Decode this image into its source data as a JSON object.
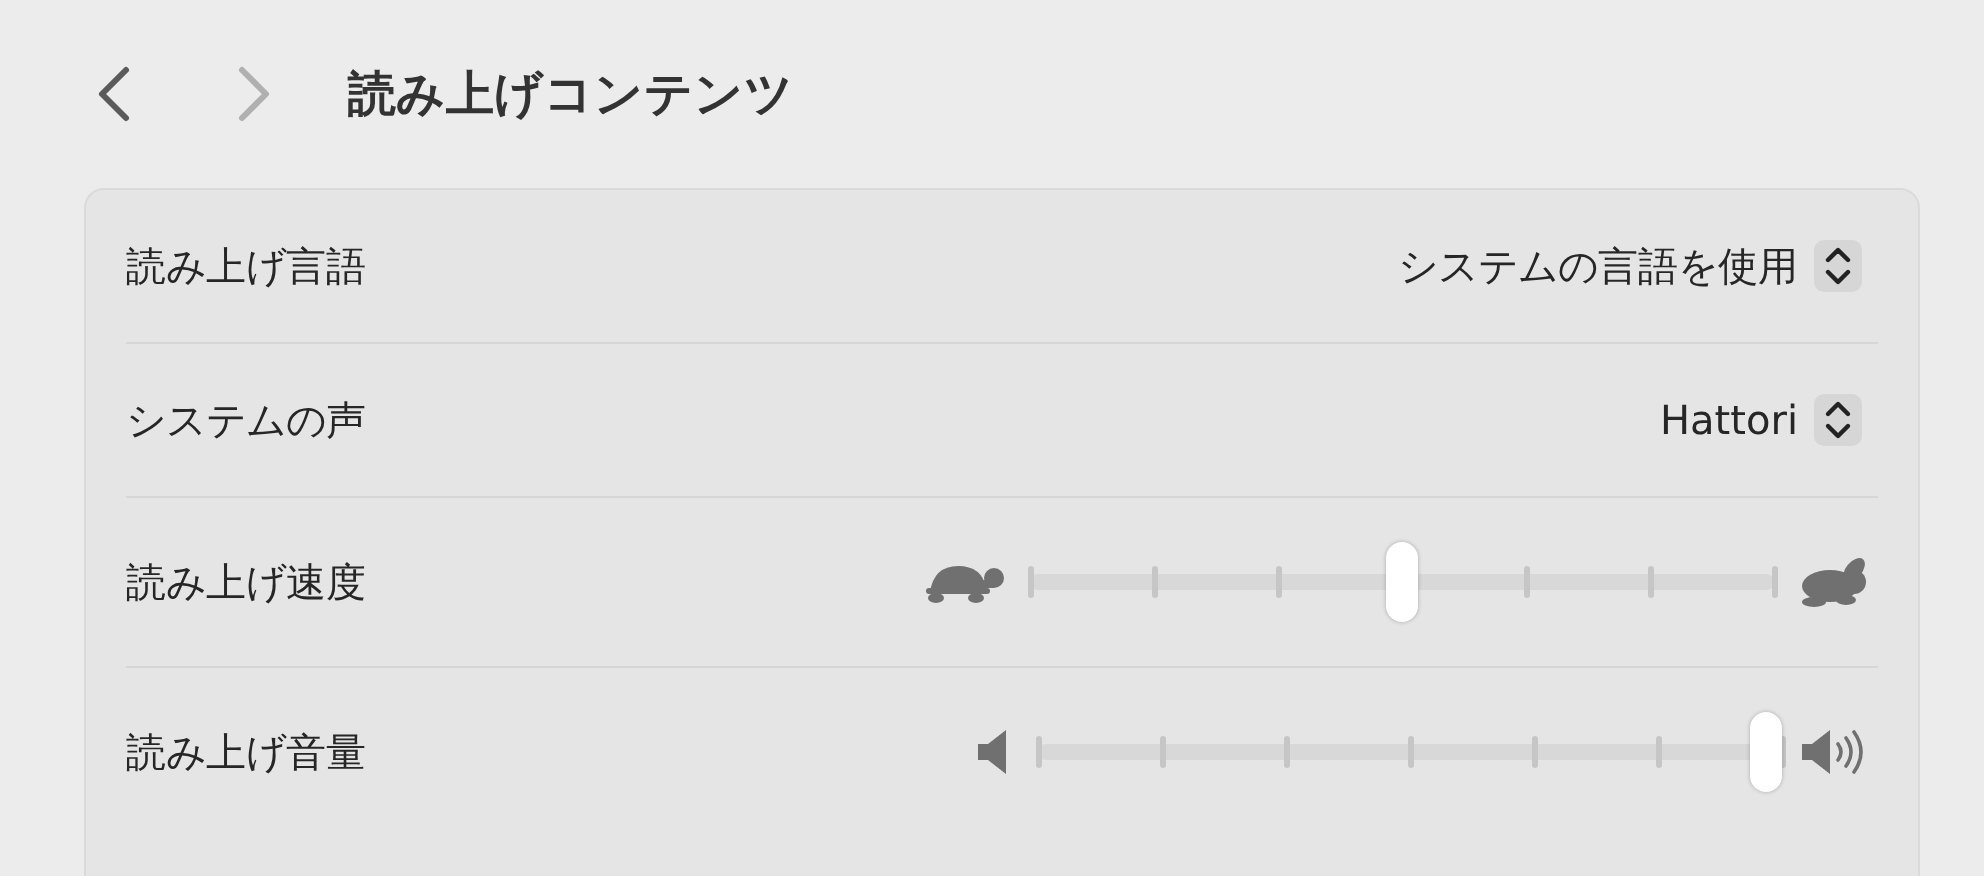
{
  "header": {
    "back": {
      "disabled": false
    },
    "forward": {
      "disabled": true
    },
    "title": "読み上げコンテンツ"
  },
  "rows": [
    {
      "kind": "popup",
      "label": "読み上げ言語",
      "value": "システムの言語を使用"
    },
    {
      "kind": "popup",
      "label": "システムの声",
      "value": "Hattori"
    },
    {
      "kind": "speed-slider",
      "label": "読み上げ速度",
      "level": 0.5
    },
    {
      "kind": "volume-slider",
      "label": "読み上げ音量",
      "level": 1
    }
  ]
}
